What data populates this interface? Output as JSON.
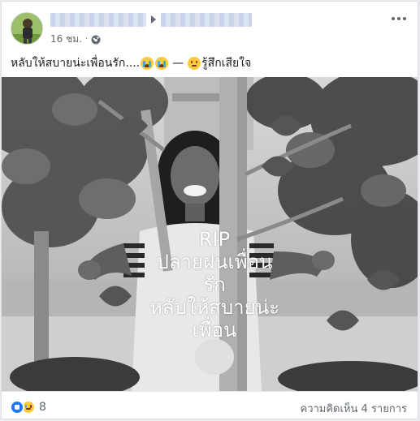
{
  "post": {
    "time": "16 ชม.",
    "meta_separator": "·",
    "privacy_icon": "globe-icon",
    "more_icon": "more-options-icon",
    "message": "หลับให้สบายน่ะเพื่อนรัก....",
    "message_emojis": [
      "loudly-crying-face",
      "loudly-crying-face"
    ],
    "feeling_separator": "—",
    "feeling_emoji": "sad-face",
    "feeling": "รู้สึกเสียใจ"
  },
  "photo": {
    "overlay_lines": [
      "RIP",
      "ปลายฝนเพื่อน",
      "รัก",
      "หลับให้สบายน่ะ",
      "เพื่อน"
    ]
  },
  "footer": {
    "reactions": [
      "like",
      "sad"
    ],
    "reaction_count": "8",
    "comments_label": "ความคิดเห็น 4 รายการ"
  },
  "colors": {
    "link_blue": "#385898",
    "meta_gray": "#616770",
    "like_blue": "#2078f4",
    "sad_yellow": "#ffc93e"
  }
}
